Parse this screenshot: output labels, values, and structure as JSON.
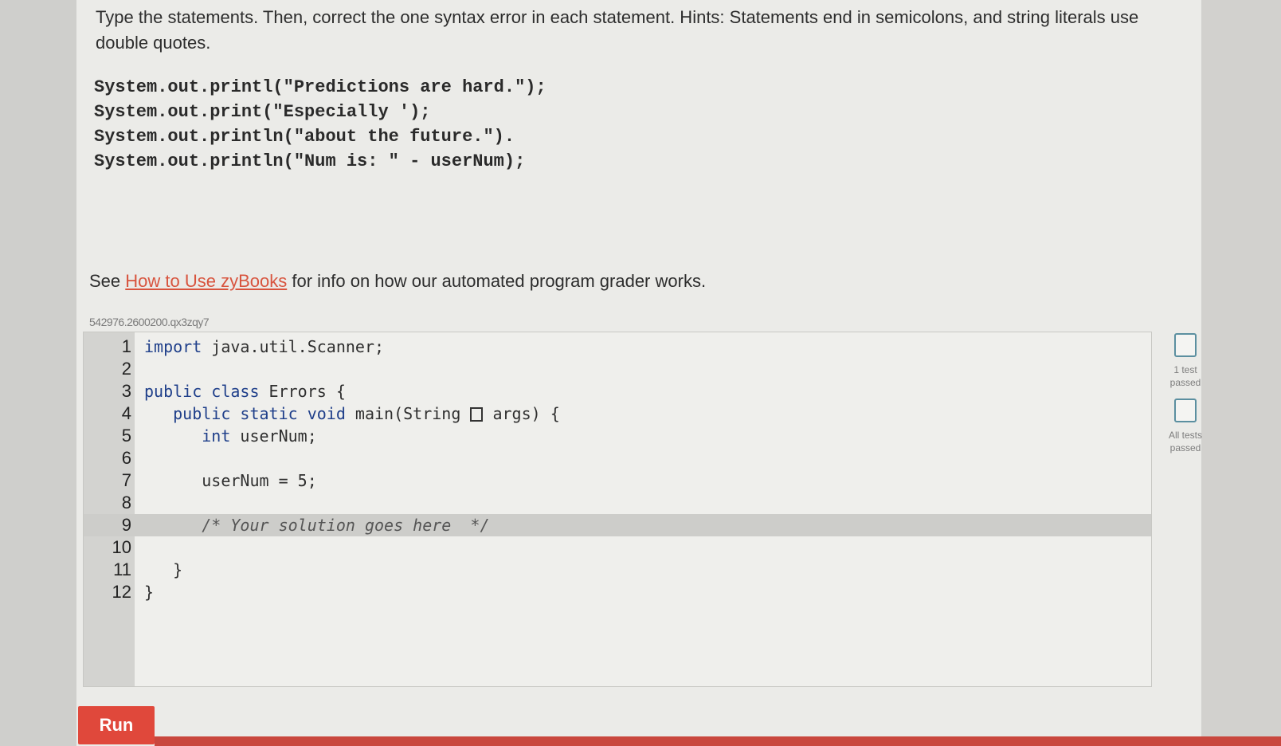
{
  "instructions": {
    "text": "Type the statements. Then, correct the one syntax error in each statement. Hints: Statements end in semicolons, and string literals use double quotes."
  },
  "statements": [
    "System.out.printl(\"Predictions are hard.\");",
    "System.out.print(\"Especially ');",
    "System.out.println(\"about the future.\").",
    "System.out.println(\"Num is: \" - userNum);"
  ],
  "help": {
    "prefix": "See ",
    "link_text": "How to Use zyBooks",
    "suffix": " for info on how our automated program grader works.",
    "link_color": "#d8543e"
  },
  "challenge_id": "542976.2600200.qx3zqy7",
  "editor": {
    "lines": [
      {
        "num": "1",
        "indent": "",
        "tokens": [
          {
            "t": "import",
            "kw": true
          },
          {
            "t": " java.util.Scanner;"
          }
        ]
      },
      {
        "num": "2",
        "indent": "",
        "tokens": []
      },
      {
        "num": "3",
        "indent": "",
        "tokens": [
          {
            "t": "public",
            "kw": true
          },
          {
            "t": " "
          },
          {
            "t": "class",
            "kw": true
          },
          {
            "t": " Errors {"
          }
        ]
      },
      {
        "num": "4",
        "indent": "   ",
        "tokens": [
          {
            "t": "public",
            "kw": true
          },
          {
            "t": " "
          },
          {
            "t": "static",
            "kw": true
          },
          {
            "t": " "
          },
          {
            "t": "void",
            "kw": true
          },
          {
            "t": " main(String "
          },
          {
            "box": true
          },
          {
            "t": " args) {"
          }
        ]
      },
      {
        "num": "5",
        "indent": "      ",
        "tokens": [
          {
            "t": "int",
            "kw": true
          },
          {
            "t": " userNum;"
          }
        ]
      },
      {
        "num": "6",
        "indent": "",
        "tokens": []
      },
      {
        "num": "7",
        "indent": "      ",
        "tokens": [
          {
            "t": "userNum = 5;"
          }
        ]
      },
      {
        "num": "8",
        "indent": "",
        "tokens": []
      },
      {
        "num": "9",
        "indent": "      ",
        "active": true,
        "tokens": [
          {
            "t": "/* Your solution goes here  */",
            "comment": true
          }
        ]
      },
      {
        "num": "10",
        "indent": "",
        "tokens": []
      },
      {
        "num": "11",
        "indent": "   ",
        "tokens": [
          {
            "t": "}"
          }
        ]
      },
      {
        "num": "12",
        "indent": "",
        "tokens": [
          {
            "t": "}"
          }
        ]
      }
    ]
  },
  "status": {
    "test1_label": "1 test passed",
    "all_label": "All tests passed"
  },
  "run_button": {
    "label": "Run",
    "color": "#e0483b"
  }
}
